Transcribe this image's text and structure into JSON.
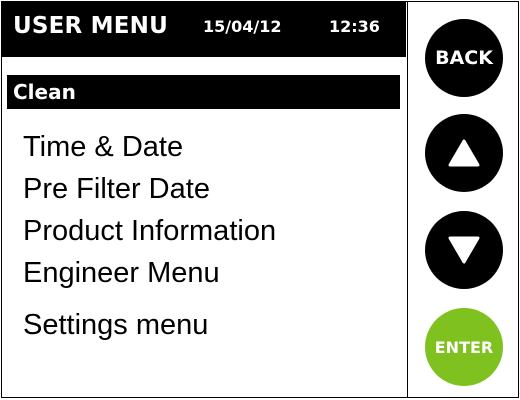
{
  "header": {
    "title": "USER MENU",
    "date": "15/04/12",
    "time": "12:36"
  },
  "menu": {
    "selected": "Clean",
    "items": [
      "Time & Date",
      "Pre Filter Date",
      "Product Information",
      "Engineer Menu",
      "Settings menu"
    ]
  },
  "buttons": {
    "back_label": "BACK",
    "up_icon": "triangle-up-icon",
    "down_icon": "triangle-down-icon",
    "enter_label": "ENTER"
  },
  "colors": {
    "enter": "#7fc11f",
    "text": "#000000",
    "background": "#ffffff"
  }
}
